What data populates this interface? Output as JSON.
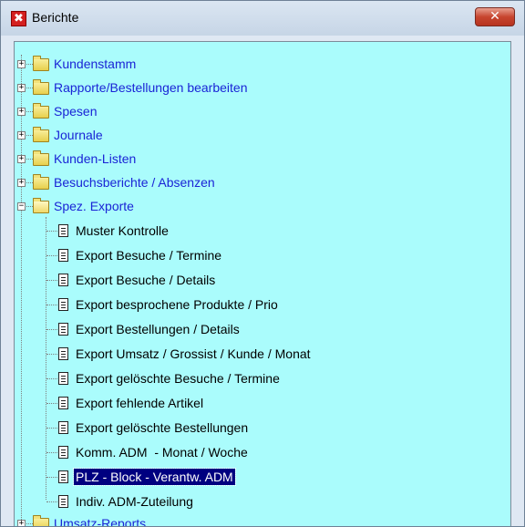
{
  "window": {
    "title": "Berichte",
    "close_glyph": "✕",
    "app_icon": "x-icon",
    "app_icon_glyph": "✖"
  },
  "tree": {
    "folders": [
      {
        "label": "Kundenstamm",
        "expanded": false
      },
      {
        "label": "Rapporte/Bestellungen bearbeiten",
        "expanded": false
      },
      {
        "label": "Spesen",
        "expanded": false
      },
      {
        "label": "Journale",
        "expanded": false
      },
      {
        "label": "Kunden-Listen",
        "expanded": false
      },
      {
        "label": "Besuchsberichte / Absenzen",
        "expanded": false
      },
      {
        "label": "Spez. Exporte",
        "expanded": true
      },
      {
        "label": "Umsatz-Reports",
        "expanded": false
      }
    ],
    "expand_glyph": "+",
    "collapse_glyph": "−",
    "items": [
      {
        "label": "Muster Kontrolle"
      },
      {
        "label": "Export Besuche / Termine"
      },
      {
        "label": "Export Besuche / Details"
      },
      {
        "label": "Export besprochene Produkte / Prio"
      },
      {
        "label": "Export Bestellungen / Details"
      },
      {
        "label": "Export Umsatz / Grossist / Kunde / Monat"
      },
      {
        "label": "Export gelöschte Besuche / Termine"
      },
      {
        "label": "Export fehlende Artikel"
      },
      {
        "label": "Export gelöschte Bestellungen"
      },
      {
        "label": "Komm. ADM  - Monat / Woche"
      },
      {
        "label": "PLZ - Block - Verantw. ADM",
        "selected": true
      },
      {
        "label": "Indiv. ADM-Zuteilung"
      }
    ]
  },
  "colors": {
    "tree_background": "#aafcfc",
    "folder_text": "#1a24d6",
    "selection": "#000080"
  }
}
